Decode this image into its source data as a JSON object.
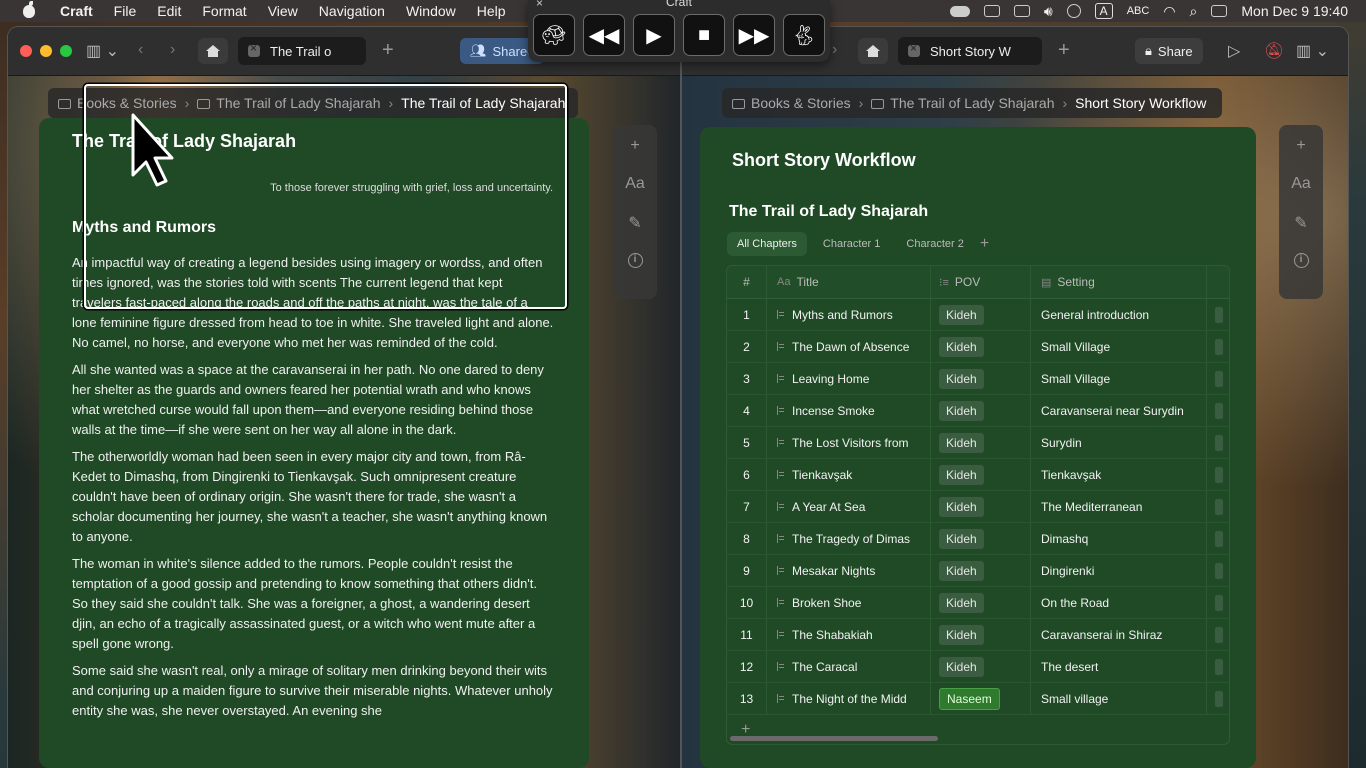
{
  "menubar": {
    "app": "Craft",
    "items": [
      "File",
      "Edit",
      "Format",
      "View",
      "Navigation",
      "Window",
      "Help"
    ],
    "input_source": "A",
    "input_label": "ABC",
    "datetime": "Mon Dec 9  19:40"
  },
  "mediabar": {
    "title": "Craft",
    "close": "×"
  },
  "left_window": {
    "tab_label": "The Trail o",
    "share_label": "Shared",
    "breadcrumb": [
      "Books & Stories",
      "The Trail of Lady Shajarah",
      "The Trail of Lady Shajarah"
    ],
    "doc_title": "The Trail of Lady Shajarah",
    "dedication": "To those forever struggling with grief, loss and uncertainty.",
    "heading": "Myths and Rumors",
    "paragraphs": [
      "An impactful way of creating a legend besides using imagery or wordss, and often times ignored, was the stories told with scents The current legend that kept travelers fast-paced along the roads and off the paths at night, was the tale of a lone feminine figure dressed from head to toe in white. She traveled light and alone. No camel, no horse, and everyone who met her was reminded of the cold.",
      "All she wanted was a space at the caravanserai in her path. No one dared to deny her shelter as the guards and owners feared her potential wrath and who knows what wretched curse would fall upon them—and everyone residing behind those walls at the time—if she were sent on her way all alone in the dark.",
      "The otherworldly woman had been seen in every major city and town, from Râ-Kedet to Dimashq, from Dingirenki to Tienkavşak. Such omnipresent creature couldn't have been of ordinary origin. She wasn't there for trade, she wasn't a scholar documenting her journey, she wasn't a teacher, she wasn't anything known to anyone.",
      "The woman in white's silence added to the rumors. People couldn't resist the temptation of a good gossip and pretending to know something that others didn't. So they said she couldn't talk. She was a foreigner, a ghost, a wandering desert djin, an echo of a tragically assassinated guest, or a witch who went mute after a spell gone wrong.",
      "Some said she wasn't real, only a mirage of solitary men drinking beyond their wits and conjuring up a maiden figure to survive their miserable nights. Whatever unholy entity she was, she never overstayed. An evening she"
    ]
  },
  "right_window": {
    "tab_label": "Short Story W",
    "share_label": "Share",
    "breadcrumb": [
      "Books & Stories",
      "The Trail of Lady Shajarah",
      "Short Story Workflow"
    ],
    "doc_title": "Short Story Workflow",
    "db_title": "The Trail of Lady Shajarah",
    "views": [
      "All Chapters",
      "Character 1",
      "Character 2"
    ],
    "columns": {
      "num": "#",
      "title": "Title",
      "pov": "POV",
      "setting": "Setting"
    },
    "rows": [
      {
        "n": "1",
        "title": "Myths and Rumors",
        "pov": "Kideh",
        "setting": "General introduction"
      },
      {
        "n": "2",
        "title": "The Dawn of Absence",
        "pov": "Kideh",
        "setting": "Small Village"
      },
      {
        "n": "3",
        "title": "Leaving Home",
        "pov": "Kideh",
        "setting": "Small Village"
      },
      {
        "n": "4",
        "title": "Incense Smoke",
        "pov": "Kideh",
        "setting": "Caravanserai near Surydin"
      },
      {
        "n": "5",
        "title": "The Lost Visitors from",
        "pov": "Kideh",
        "setting": "Surydin"
      },
      {
        "n": "6",
        "title": "Tienkavşak",
        "pov": "Kideh",
        "setting": "Tienkavşak"
      },
      {
        "n": "7",
        "title": "A Year At Sea",
        "pov": "Kideh",
        "setting": "The Mediterranean"
      },
      {
        "n": "8",
        "title": "The Tragedy of Dimas",
        "pov": "Kideh",
        "setting": "Dimashq"
      },
      {
        "n": "9",
        "title": "Mesakar Nights",
        "pov": "Kideh",
        "setting": "Dingirenki"
      },
      {
        "n": "10",
        "title": "Broken Shoe",
        "pov": "Kideh",
        "setting": "On the Road"
      },
      {
        "n": "11",
        "title": "The Shabakiah",
        "pov": "Kideh",
        "setting": "Caravanserai in Shiraz"
      },
      {
        "n": "12",
        "title": "The Caracal",
        "pov": "Kideh",
        "setting": "The desert"
      },
      {
        "n": "13",
        "title": "The Night of the Midd",
        "pov": "Naseem",
        "setting": "Small village"
      }
    ]
  },
  "colors": {
    "doc_bg": "#1f4a25",
    "naseem_tag": "#2f7a2f",
    "kideh_tag": "#3a5c40"
  }
}
